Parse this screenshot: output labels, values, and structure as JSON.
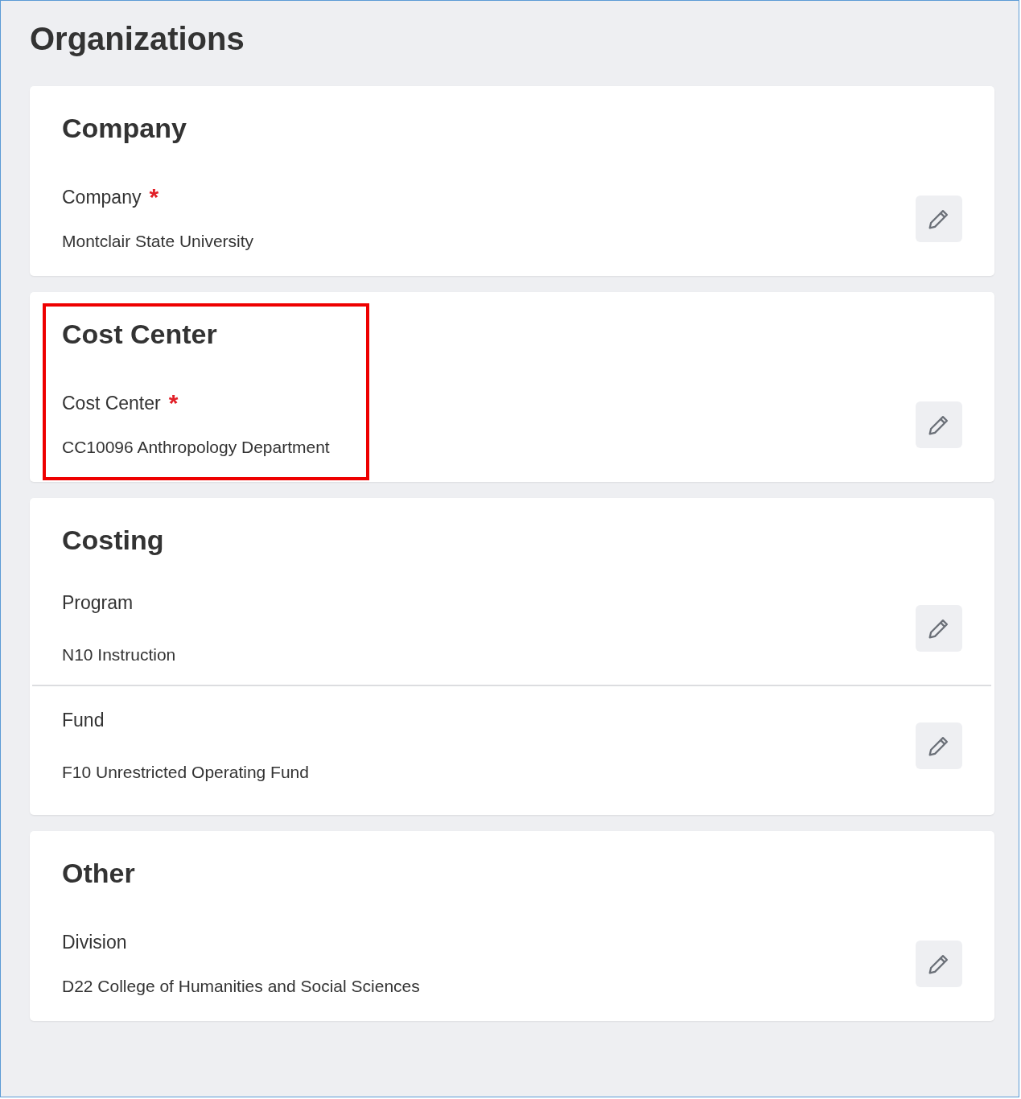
{
  "title": "Organizations",
  "sections": [
    {
      "heading": "Company",
      "highlighted": false,
      "fields": [
        {
          "label": "Company",
          "required_mark": "*",
          "value": "Montclair State University"
        }
      ]
    },
    {
      "heading": "Cost Center",
      "highlighted": true,
      "fields": [
        {
          "label": "Cost Center",
          "required_mark": "*",
          "value": "CC10096 Anthropology Department"
        }
      ]
    },
    {
      "heading": "Costing",
      "highlighted": false,
      "fields": [
        {
          "label": "Program",
          "value": "N10 Instruction"
        },
        {
          "label": "Fund",
          "value": "F10 Unrestricted Operating Fund"
        }
      ]
    },
    {
      "heading": "Other",
      "highlighted": false,
      "fields": [
        {
          "label": "Division",
          "value": "D22 College of Humanities and Social Sciences"
        }
      ]
    }
  ]
}
